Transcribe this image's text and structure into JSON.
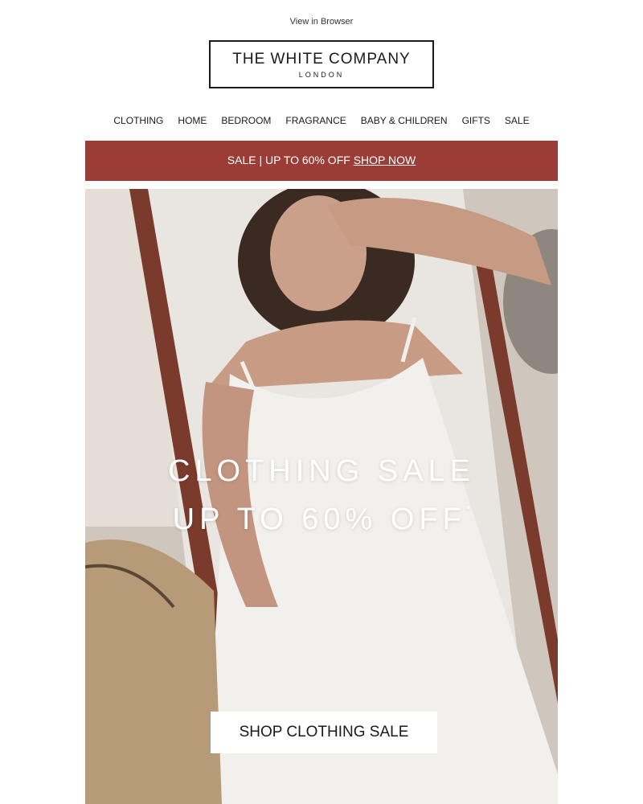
{
  "header": {
    "view_in_browser": "View in Browser",
    "logo_main": "THE WHITE COMPANY",
    "logo_sub": "LONDON"
  },
  "nav": {
    "items": [
      "CLOTHING",
      "HOME",
      "BEDROOM",
      "FRAGRANCE",
      "BABY & CHILDREN",
      "GIFTS",
      "SALE"
    ]
  },
  "promo": {
    "text": "SALE | UP TO 60% OFF",
    "link": "SHOP NOW",
    "color": "#9b3d36"
  },
  "hero": {
    "title": "CLOTHING SALE",
    "subtitle": "UP TO 60% OFF",
    "asterisk": "*",
    "cta": "SHOP CLOTHING SALE"
  }
}
